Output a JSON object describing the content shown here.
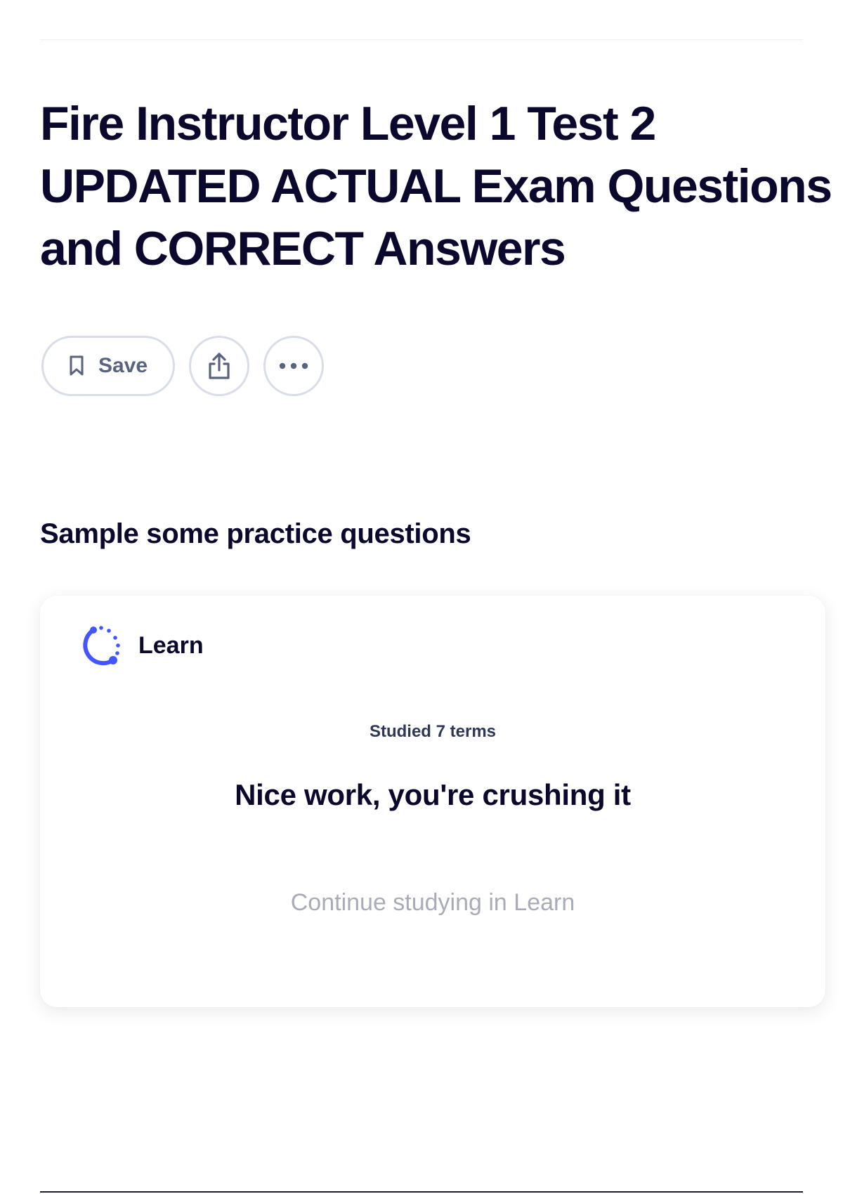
{
  "page": {
    "title": "Fire Instructor Level 1 Test 2 UPDATED ACTUAL Exam Questions and CORRECT Answers"
  },
  "actions": {
    "save_label": "Save",
    "save_icon": "bookmark-icon",
    "share_icon": "share-icon",
    "more_icon": "more-horizontal-icon"
  },
  "practice": {
    "heading": "Sample some practice questions",
    "card": {
      "mode_label": "Learn",
      "mode_icon": "learn-progress-icon",
      "studied_text": "Studied 7 terms",
      "message": "Nice work, you're crushing it",
      "continue_label": "Continue studying in Learn"
    }
  },
  "colors": {
    "text_primary": "#0a092d",
    "text_secondary": "#586380",
    "border": "#d9dde8",
    "accent": "#4255ff",
    "muted": "#a8abb8"
  }
}
